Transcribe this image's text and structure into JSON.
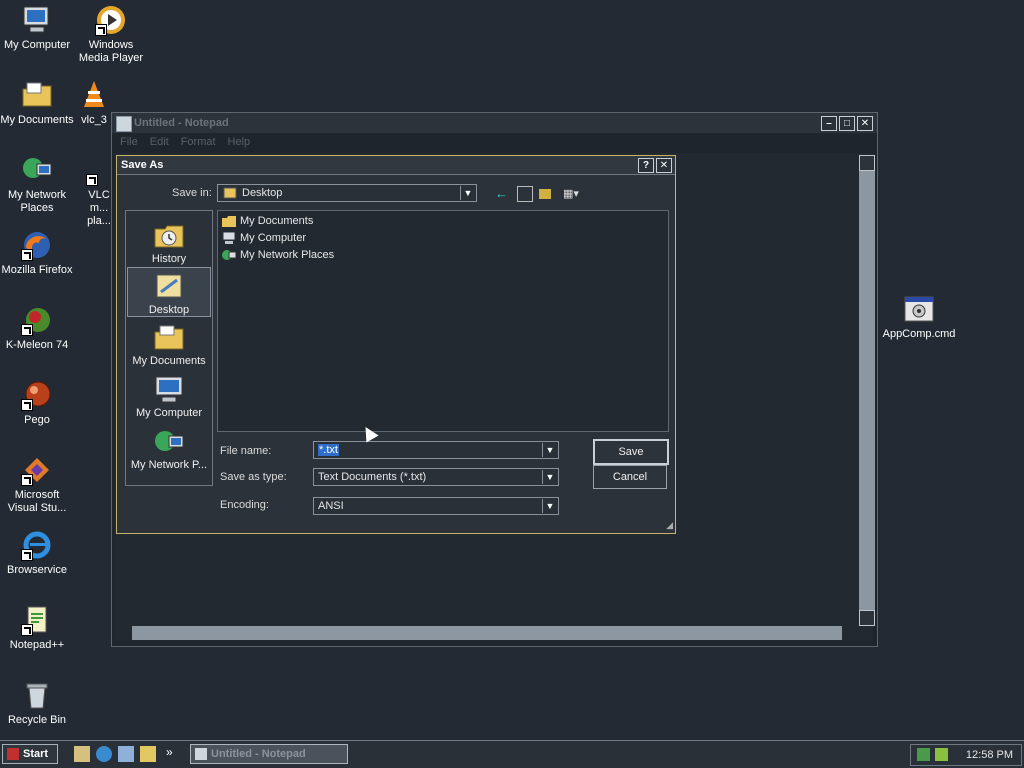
{
  "desktop": {
    "icons": [
      {
        "label": "My Computer"
      },
      {
        "label": "Windows Media Player"
      },
      {
        "label": "My Documents"
      },
      {
        "label": "vlc_3"
      },
      {
        "label": "My Network Places"
      },
      {
        "label": "VLC m... pla..."
      },
      {
        "label": "Mozilla Firefox"
      },
      {
        "label": "K-Meleon 74"
      },
      {
        "label": "Pego"
      },
      {
        "label": "Microsoft Visual Stu..."
      },
      {
        "label": "Browservice"
      },
      {
        "label": "Notepad++"
      },
      {
        "label": "Recycle Bin"
      },
      {
        "label": "AppComp.cmd"
      }
    ]
  },
  "notepad": {
    "title": "Untitled - Notepad",
    "menu": [
      "File",
      "Edit",
      "Format",
      "Help"
    ]
  },
  "dialog": {
    "title": "Save As",
    "help_btn": "?",
    "close_btn": "✕",
    "save_in_label": "Save in:",
    "save_in_value": "Desktop",
    "places": [
      {
        "label": "History"
      },
      {
        "label": "Desktop"
      },
      {
        "label": "My Documents"
      },
      {
        "label": "My Computer"
      },
      {
        "label": "My Network P..."
      }
    ],
    "files": [
      {
        "name": "My Documents"
      },
      {
        "name": "My Computer"
      },
      {
        "name": "My Network Places"
      }
    ],
    "file_name_label": "File name:",
    "file_name_value": "*.txt",
    "save_as_type_label": "Save as type:",
    "save_as_type_value": "Text Documents (*.txt)",
    "encoding_label": "Encoding:",
    "encoding_value": "ANSI",
    "save_button": "Save",
    "cancel_button": "Cancel"
  },
  "taskbar": {
    "start": "Start",
    "task": "Untitled - Notepad",
    "clock": "12:58 PM"
  }
}
